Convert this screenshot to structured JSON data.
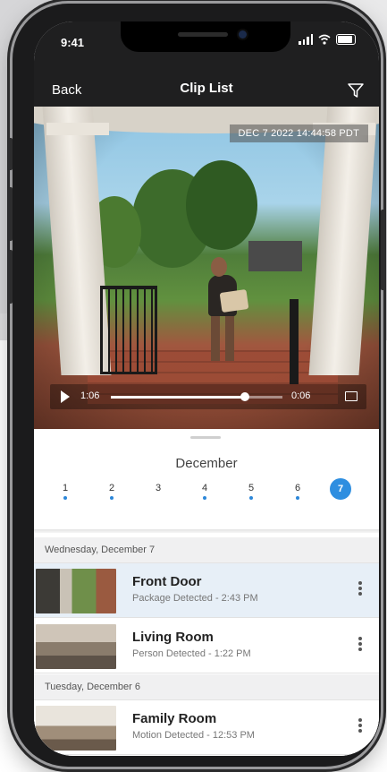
{
  "status_bar": {
    "time": "9:41"
  },
  "nav": {
    "back_label": "Back",
    "title": "Clip List",
    "filter_icon": "filter-icon"
  },
  "video": {
    "timestamp": "DEC 7 2022 14:44:58 PDT",
    "current_time": "1:06",
    "end_time": "0:06",
    "progress": 0.78
  },
  "calendar": {
    "month": "December",
    "days": [
      {
        "label": "1",
        "has_clips": true
      },
      {
        "label": "2",
        "has_clips": true
      },
      {
        "label": "3",
        "has_clips": false
      },
      {
        "label": "4",
        "has_clips": true
      },
      {
        "label": "5",
        "has_clips": true
      },
      {
        "label": "6",
        "has_clips": true
      },
      {
        "label": "7",
        "has_clips": true,
        "selected": true
      }
    ]
  },
  "clip_groups": [
    {
      "date": "Wednesday, December 7",
      "clips": [
        {
          "title": "Front Door",
          "subtitle": "Package Detected - 2:43 PM",
          "selected": true
        },
        {
          "title": "Living Room",
          "subtitle": "Person Detected - 1:22 PM",
          "selected": false
        }
      ]
    },
    {
      "date": "Tuesday, December 6",
      "clips": [
        {
          "title": "Family Room",
          "subtitle": "Motion Detected - 12:53 PM",
          "selected": false
        }
      ]
    }
  ],
  "colors": {
    "accent": "#2e8ee0",
    "topbar": "#1f1f20",
    "selected_row": "#e7eff7"
  }
}
